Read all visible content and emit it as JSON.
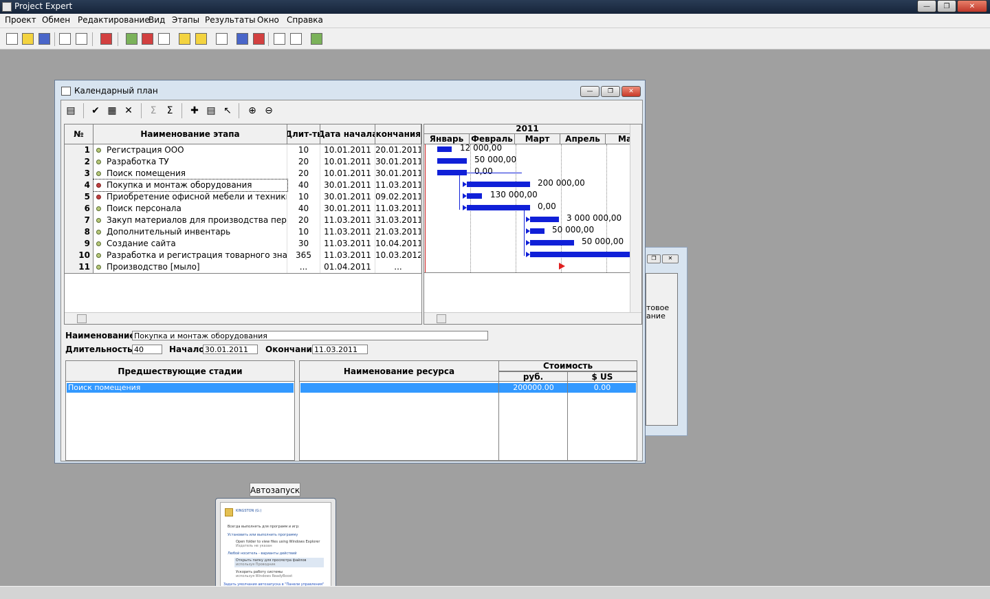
{
  "app": {
    "title": "Project Expert"
  },
  "menu": [
    "Проект",
    "Обмен",
    "Редактирование",
    "Вид",
    "Этапы",
    "Результаты",
    "Окно",
    "Справка"
  ],
  "window": {
    "title": "Календарный план"
  },
  "grid": {
    "headers": [
      "№",
      "Наименование этапа",
      "Длит-ть",
      "Дата начала",
      "Дата окончания"
    ],
    "rows": [
      {
        "n": "1",
        "name": "Регистрация ООО",
        "dur": "10",
        "start": "10.01.2011",
        "end": "20.01.2011"
      },
      {
        "n": "2",
        "name": "Разработка ТУ",
        "dur": "20",
        "start": "10.01.2011",
        "end": "30.01.2011"
      },
      {
        "n": "3",
        "name": "Поиск помещения",
        "dur": "20",
        "start": "10.01.2011",
        "end": "30.01.2011"
      },
      {
        "n": "4",
        "name": "Покупка и монтаж оборудования",
        "dur": "40",
        "start": "30.01.2011",
        "end": "11.03.2011"
      },
      {
        "n": "5",
        "name": "Приобретение офисной мебели и техники",
        "dur": "10",
        "start": "30.01.2011",
        "end": "09.02.2011"
      },
      {
        "n": "6",
        "name": "Поиск персонала",
        "dur": "40",
        "start": "30.01.2011",
        "end": "11.03.2011"
      },
      {
        "n": "7",
        "name": "Закуп материалов для производства первой",
        "dur": "20",
        "start": "11.03.2011",
        "end": "31.03.2011"
      },
      {
        "n": "8",
        "name": "Дополнительный инвентарь",
        "dur": "10",
        "start": "11.03.2011",
        "end": "21.03.2011"
      },
      {
        "n": "9",
        "name": "Создание сайта",
        "dur": "30",
        "start": "11.03.2011",
        "end": "10.04.2011"
      },
      {
        "n": "10",
        "name": "Разработка и регистрация товарного знака",
        "dur": "365",
        "start": "11.03.2011",
        "end": "10.03.2012"
      },
      {
        "n": "11",
        "name": "Производство [мыло]",
        "dur": "...",
        "start": "01.04.2011",
        "end": "..."
      }
    ]
  },
  "gantt": {
    "year": "2011",
    "months": [
      "Январь",
      "Февраль",
      "Март",
      "Апрель",
      "Ма"
    ],
    "labels": [
      "12 000,00",
      "50 000,00",
      "0,00",
      "200 000,00",
      "130 000,00",
      "0,00",
      "3 000 000,00",
      "50 000,00",
      "50 000,00"
    ]
  },
  "detail": {
    "name_label": "Наименование:",
    "name_value": "Покупка и монтаж оборудования",
    "dur_label": "Длительность:",
    "dur_value": "40",
    "start_label": "Начало:",
    "start_value": "30.01.2011",
    "end_label": "Окончание:",
    "end_value": "11.03.2011",
    "pred_header": "Предшествующие стадии",
    "pred_row": "Поиск помещения",
    "res_header": "Наименование ресурса",
    "cost_header": "Стоимость",
    "rub_header": "руб.",
    "usd_header": "$ US",
    "rub_value": "200000.00",
    "usd_value": "0.00"
  },
  "bgwin": {
    "text1": "товое",
    "text2": "ание"
  },
  "tooltip": "Автозапуск",
  "thumb": {
    "drive": "KINGSTON (G:)",
    "opt1": "Всегда выполнять для программ и игр:",
    "sec1": "Установить или выполнить программу",
    "item1": "Open folder to view files using Windows Explorer",
    "item1sub": "Издатель не указан",
    "sec2": "Любой носитель - варианты действий",
    "item2": "Открыть папку для просмотра файлов",
    "item2sub": "используя Проводник",
    "item3": "Ускорить работу системы",
    "item3sub": "используя Windows ReadyBoost",
    "link": "Задать умолчания автозапуска в \"Панели управления\""
  }
}
